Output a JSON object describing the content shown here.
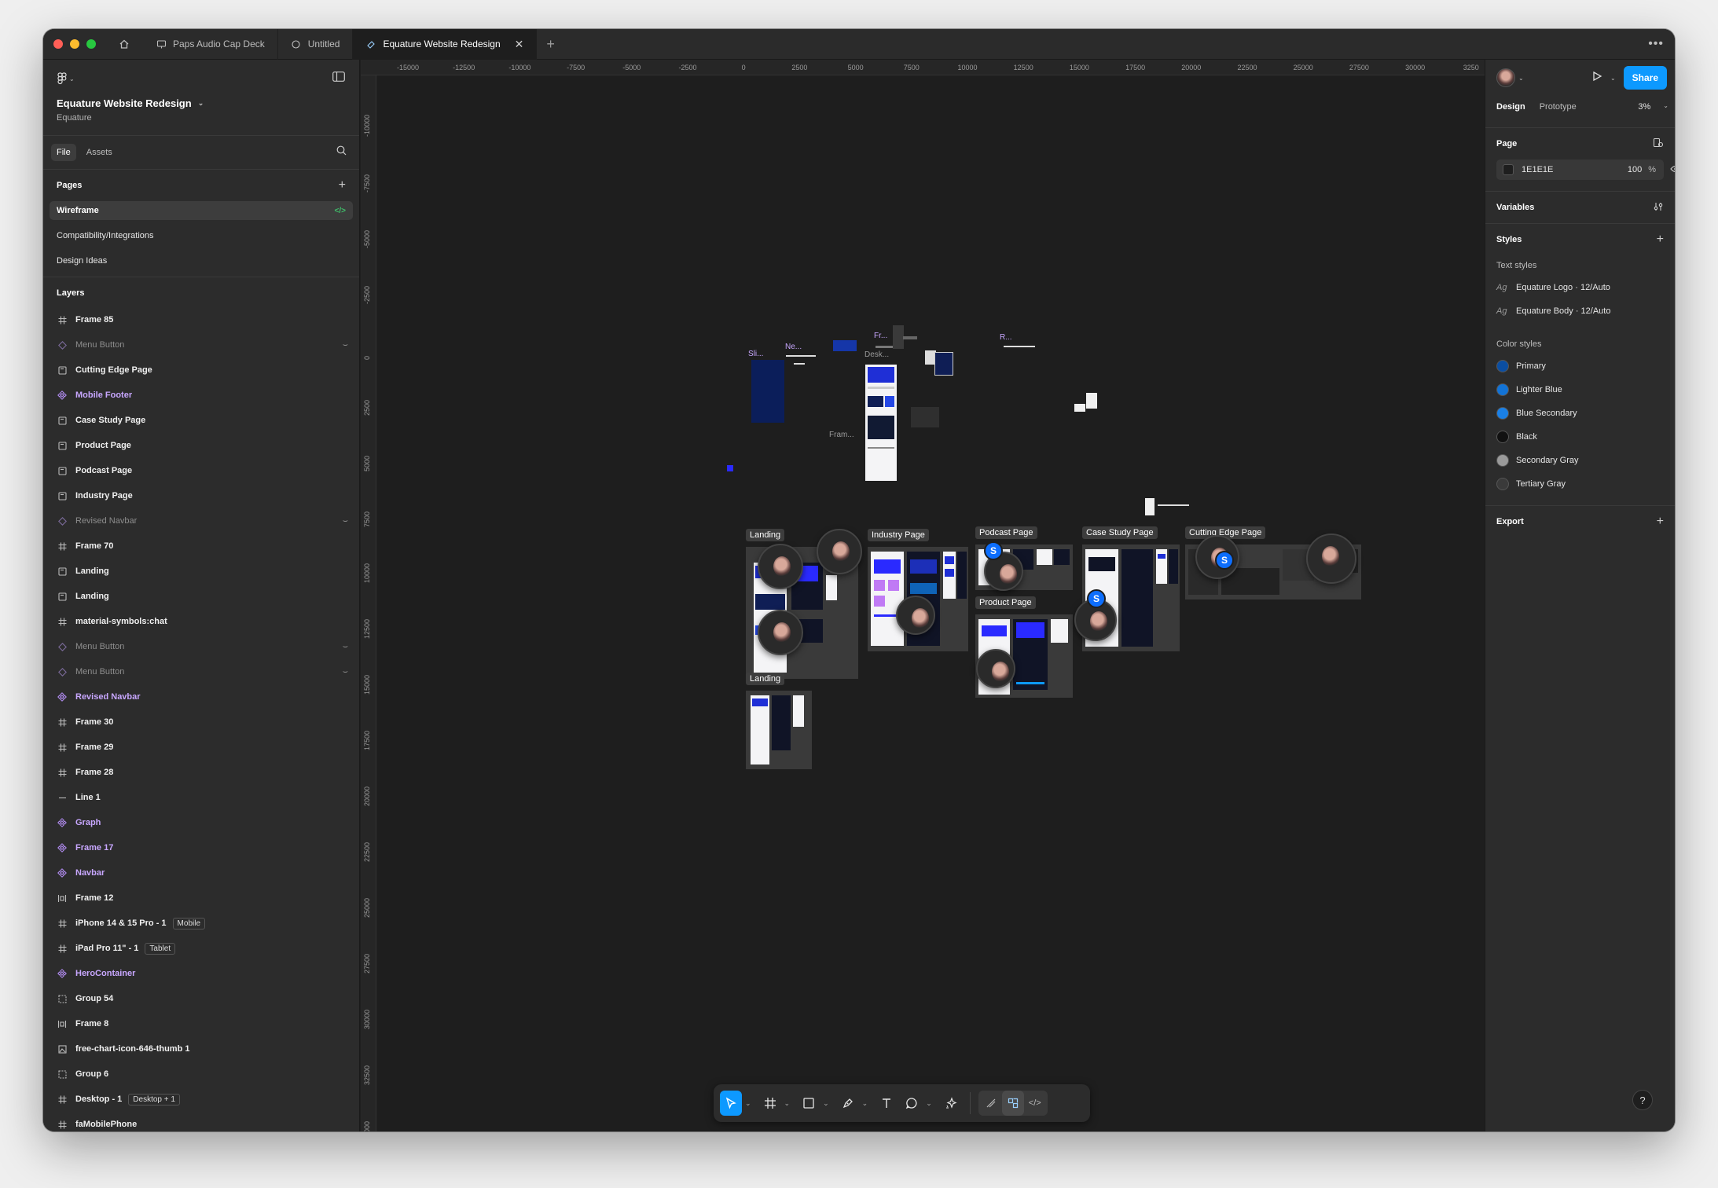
{
  "tabs": [
    {
      "label": "Paps Audio Cap Deck"
    },
    {
      "label": "Untitled"
    },
    {
      "label": "Equature Website Redesign"
    }
  ],
  "project": {
    "title": "Equature Website Redesign",
    "team": "Equature"
  },
  "file_tabs": {
    "file": "File",
    "assets": "Assets"
  },
  "pages": {
    "heading": "Pages",
    "items": [
      {
        "label": "Wireframe"
      },
      {
        "label": "Compatibility/Integrations"
      },
      {
        "label": "Design Ideas"
      }
    ]
  },
  "layers": {
    "heading": "Layers",
    "items": [
      {
        "label": "Frame 85",
        "kind": "frame"
      },
      {
        "label": "Menu Button",
        "kind": "instance"
      },
      {
        "label": "Cutting Edge Page",
        "kind": "section"
      },
      {
        "label": "Mobile Footer",
        "kind": "component"
      },
      {
        "label": "Case Study Page",
        "kind": "section"
      },
      {
        "label": "Product Page",
        "kind": "section"
      },
      {
        "label": "Podcast Page",
        "kind": "section"
      },
      {
        "label": "Industry Page",
        "kind": "section"
      },
      {
        "label": "Revised Navbar",
        "kind": "instance"
      },
      {
        "label": "Frame 70",
        "kind": "frame"
      },
      {
        "label": "Landing",
        "kind": "section"
      },
      {
        "label": "Landing",
        "kind": "section"
      },
      {
        "label": "material-symbols:chat",
        "kind": "frame"
      },
      {
        "label": "Menu Button",
        "kind": "instance"
      },
      {
        "label": "Menu Button",
        "kind": "instance"
      },
      {
        "label": "Revised Navbar",
        "kind": "component"
      },
      {
        "label": "Frame 30",
        "kind": "frame"
      },
      {
        "label": "Frame 29",
        "kind": "frame"
      },
      {
        "label": "Frame 28",
        "kind": "frame"
      },
      {
        "label": "Line 1",
        "kind": "line"
      },
      {
        "label": "Graph",
        "kind": "component"
      },
      {
        "label": "Frame 17",
        "kind": "component"
      },
      {
        "label": "Navbar",
        "kind": "component"
      },
      {
        "label": "Frame 12",
        "kind": "autolayout"
      },
      {
        "label": "iPhone 14 & 15 Pro - 1",
        "kind": "frame",
        "badge": "Mobile"
      },
      {
        "label": "iPad Pro 11\" - 1",
        "kind": "frame",
        "badge": "Tablet"
      },
      {
        "label": "HeroContainer",
        "kind": "component"
      },
      {
        "label": "Group 54",
        "kind": "group"
      },
      {
        "label": "Frame 8",
        "kind": "autolayout"
      },
      {
        "label": "free-chart-icon-646-thumb 1",
        "kind": "image"
      },
      {
        "label": "Group 6",
        "kind": "group"
      },
      {
        "label": "Desktop - 1",
        "kind": "frame",
        "badge": "Desktop + 1"
      },
      {
        "label": "faMobilePhone",
        "kind": "frame"
      }
    ]
  },
  "ruler_top": [
    "-15000",
    "-12500",
    "-10000",
    "-7500",
    "-5000",
    "-2500",
    "0",
    "2500",
    "5000",
    "7500",
    "10000",
    "12500",
    "15000",
    "17500",
    "20000",
    "22500",
    "25000",
    "27500",
    "30000",
    "3250"
  ],
  "ruler_left": [
    "-10000",
    "-7500",
    "-5000",
    "-2500",
    "0",
    "2500",
    "5000",
    "7500",
    "10000",
    "12500",
    "15000",
    "17500",
    "20000",
    "22500",
    "25000",
    "27500",
    "30000",
    "32500",
    "35000"
  ],
  "canvas": {
    "sections": {
      "landing_1": "Landing",
      "landing_2": "Landing",
      "industry": "Industry Page",
      "podcast": "Podcast Page",
      "product": "Product Page",
      "case_study": "Case Study Page",
      "cutting_edge": "Cutting Edge Page"
    },
    "mini_labels": {
      "sli": "Sli...",
      "ne": "Ne...",
      "fr": "Fr...",
      "desk": "Desk...",
      "r": "R...",
      "fram": "Fram..."
    },
    "avatar_initial": "S"
  },
  "right_panel": {
    "share": "Share",
    "design_tab": "Design",
    "prototype_tab": "Prototype",
    "zoom": "3%",
    "page_heading": "Page",
    "page_color": "1E1E1E",
    "page_opacity": "100",
    "percent": "%",
    "variables": "Variables",
    "styles": "Styles",
    "text_styles_heading": "Text styles",
    "text_styles": [
      {
        "label": "Equature Logo · 12/Auto"
      },
      {
        "label": "Equature Body · 12/Auto"
      }
    ],
    "color_styles_heading": "Color styles",
    "color_styles": [
      {
        "label": "Primary",
        "color": "#0b4ea2"
      },
      {
        "label": "Lighter Blue",
        "color": "#1273d6"
      },
      {
        "label": "Blue Secondary",
        "color": "#1a80e6"
      },
      {
        "label": "Black",
        "color": "#111111"
      },
      {
        "label": "Secondary Gray",
        "color": "#9a9a9a"
      },
      {
        "label": "Tertiary Gray",
        "color": "#3a3a3a"
      }
    ],
    "export": "Export",
    "help": "?"
  },
  "colors": {
    "accent": "#0d99ff",
    "component": "#c8a7ff",
    "canvas": "#1e1e1e"
  }
}
